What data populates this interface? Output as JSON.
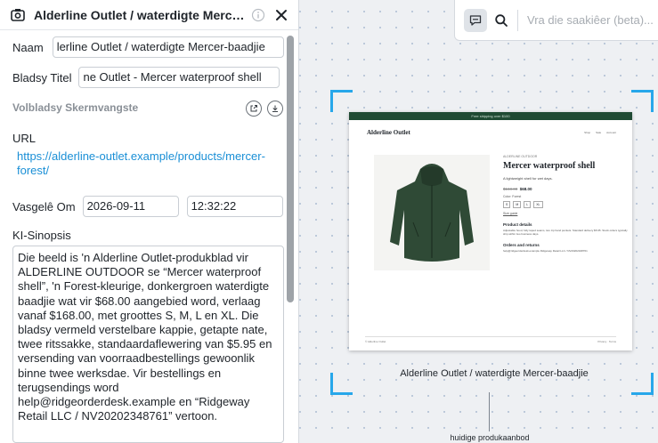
{
  "panel": {
    "title": "Alderline Outlet / waterdigte Mercer-baadjie",
    "name_label": "Naam",
    "name_value": "lerline Outlet / waterdigte Mercer-baadjie",
    "page_title_label": "Bladsy Titel",
    "page_title_value": "ne Outlet - Mercer waterproof shell",
    "fullpage_label": "Volbladsy Skermvangste",
    "url_label": "URL",
    "url_value": "https://alderline-outlet.example/products/mercer-forest/",
    "captured_label": "Vasgelê Om",
    "captured_date": "2026-09-11",
    "captured_time": "12:32:22",
    "summary_label": "KI-Sinopsis",
    "summary_text": "Die beeld is 'n Alderline Outlet-produkblad vir ALDERLINE OUTDOOR se “Mercer waterproof shell”, 'n Forest-kleurige, donkergroen waterdigte baadjie wat vir $68.00 aangebied word, verlaag vanaf $168.00, met groottes S, M, L en XL. Die bladsy vermeld verstelbare kappie, getapte nate, twee ritssakke, standaardaflewering van $5.95 en versending van voorraadbestellings gewoonlik binne twee werksdae. Vir bestellings en terugsendings word help@ridgeorderdesk.example en “Ridgeway Retail LLC / NV20202348761” vertoon."
  },
  "search": {
    "placeholder": "Vra die saakiêer (beta)..."
  },
  "canvas": {
    "frame_caption": "Alderline Outlet / waterdigte Mercer-baadjie",
    "node_label": "huidige produkaanbod"
  },
  "thumbnail": {
    "banner": "Free shipping over $100",
    "logo": "Alderline Outlet",
    "nav": [
      "Shop",
      "Sale",
      "Account"
    ],
    "brand_crumb": "ALDERLINE OUTDOOR",
    "product_title": "Mercer waterproof shell",
    "subtitle": "A lightweight shell for wet days.",
    "price_old": "$168.00",
    "price_new": "$68.00",
    "color_line": "Color: Forest",
    "sizes": [
      "S",
      "M",
      "L",
      "XL"
    ],
    "size_guide": "Size guide",
    "details_heading": "Product details",
    "details_text": "Adjustable hood, fully taped seams, two zip hand pockets. Standard delivery $5.95. Stock orders typically ship within two business days.",
    "orders_heading": "Orders and returns",
    "orders_text": "help@ridgeorderdesk.example Ridgeway Retail LLC / NV20202348761",
    "footer_left": "© Alderline Outlet",
    "footer_right": "Privacy · Terms"
  },
  "colors": {
    "accent": "#27a7ea",
    "link": "#1a8fd6",
    "jacket": "#2f4a36",
    "banner": "#1f4a33"
  }
}
